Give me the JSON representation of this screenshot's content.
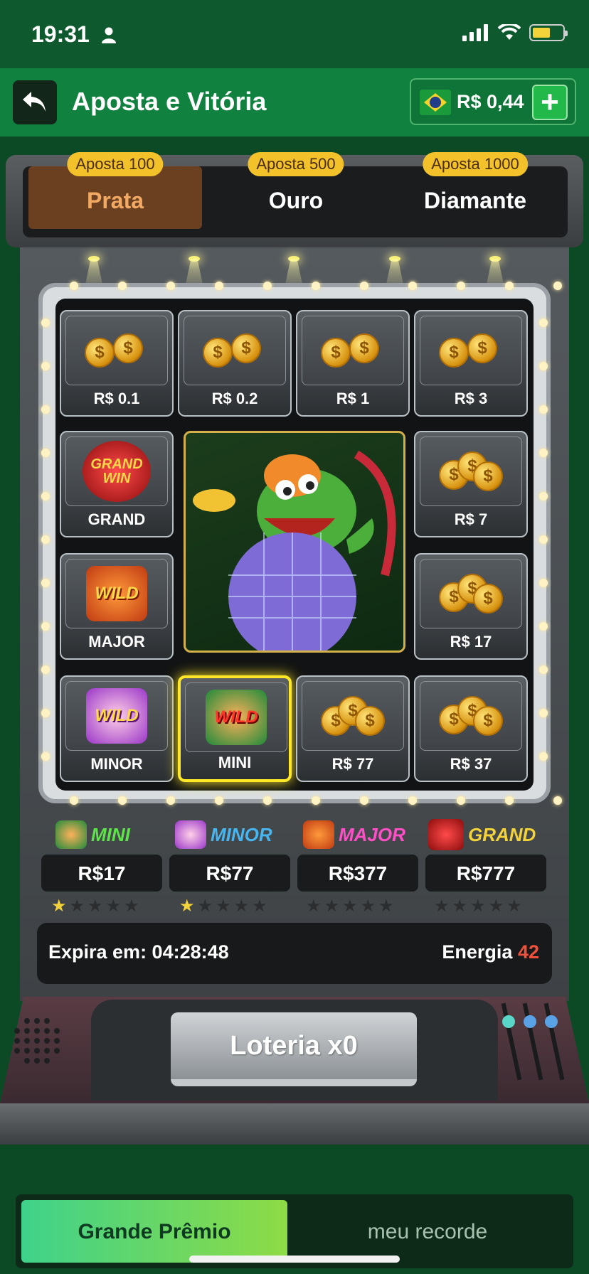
{
  "status": {
    "time": "19:31"
  },
  "header": {
    "title": "Aposta e Vitória",
    "balance": "R$ 0,44"
  },
  "tabs": [
    {
      "badge": "Aposta 100",
      "label": "Prata",
      "active": true
    },
    {
      "badge": "Aposta 500",
      "label": "Ouro",
      "active": false
    },
    {
      "badge": "Aposta 1000",
      "label": "Diamante",
      "active": false
    }
  ],
  "cells": {
    "c1": "R$ 0.1",
    "c2": "R$ 0.2",
    "c3": "R$ 1",
    "c4": "R$ 3",
    "c5": "GRAND",
    "c6": "R$ 7",
    "c7": "MAJOR",
    "c8": "R$ 17",
    "c9": "MINOR",
    "c10": "MINI",
    "c11": "R$ 77",
    "c12": "R$ 37"
  },
  "icon_text": {
    "wild": "WILD",
    "grandwin": "GRAND WIN"
  },
  "jackpots": [
    {
      "name": "MINI",
      "value": "R$17",
      "stars_on": 1
    },
    {
      "name": "MINOR",
      "value": "R$77",
      "stars_on": 1
    },
    {
      "name": "MAJOR",
      "value": "R$377",
      "stars_on": 0
    },
    {
      "name": "GRAND",
      "value": "R$777",
      "stars_on": 0
    }
  ],
  "info": {
    "expires_label": "Expira em: 04:28:48",
    "energy_label": "Energia",
    "energy_value": "42"
  },
  "lottery_button": "Loteria x0",
  "bottom_tabs": {
    "active": "Grande Prêmio",
    "other": "meu recorde"
  },
  "colors": {
    "accent": "#11813f",
    "selected": "#ffe827",
    "energy": "#f0513a"
  }
}
